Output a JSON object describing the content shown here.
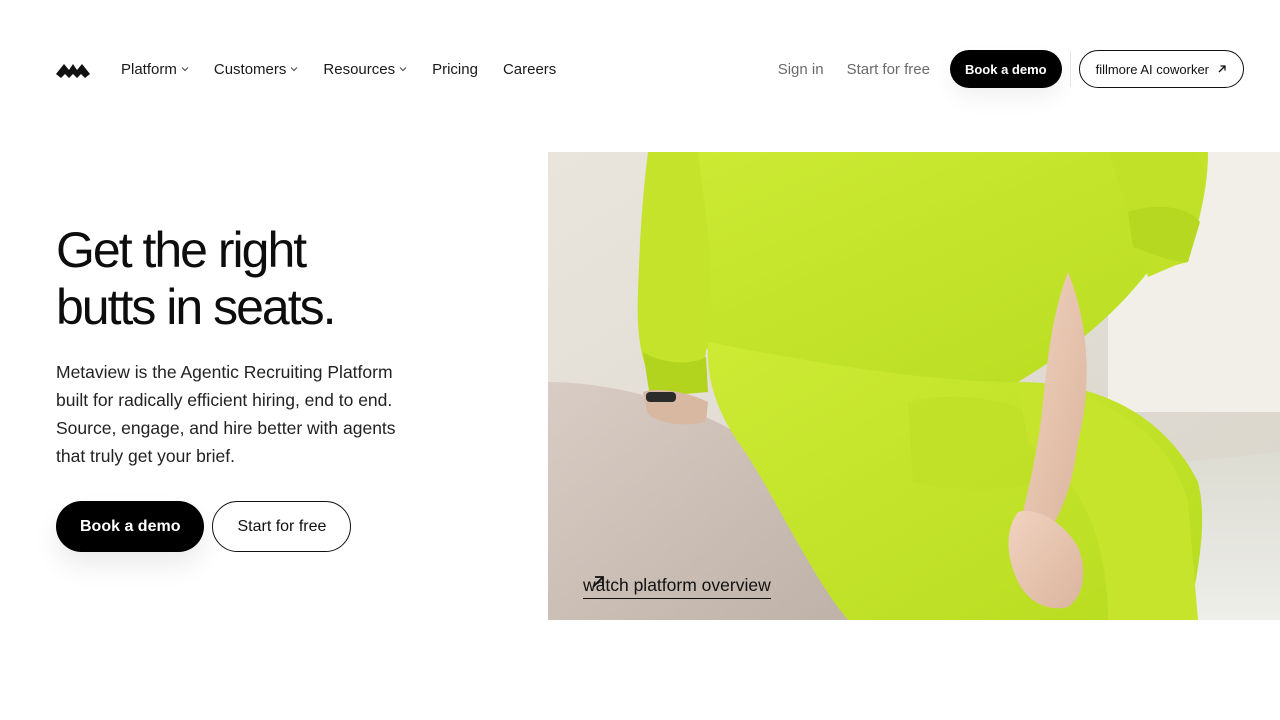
{
  "nav": {
    "logo": "metaview-logo-icon",
    "items": [
      {
        "label": "Platform",
        "has_dropdown": true
      },
      {
        "label": "Customers",
        "has_dropdown": true
      },
      {
        "label": "Resources",
        "has_dropdown": true
      },
      {
        "label": "Pricing",
        "has_dropdown": false
      },
      {
        "label": "Careers",
        "has_dropdown": false
      }
    ],
    "sign_in": "Sign in",
    "start_for_free": "Start for free",
    "book_demo": "Book a demo",
    "ai_coworker": "fillmore AI coworker"
  },
  "hero": {
    "title_lines": [
      "Get the right",
      "butts in seats."
    ],
    "description_lines": [
      "Metaview is the Agentic Recruiting Platform",
      "built for radically efficient hiring, end to end.",
      "Source, engage, and hire better with agents",
      "that truly get your brief."
    ],
    "book_demo": "Book a demo",
    "start_for_free": "Start for free",
    "watch_link": "watch platform overview"
  },
  "colors": {
    "primary": "#000000",
    "muted_text": "#6b6b6b",
    "accent_lime": "#c9ea2c"
  }
}
